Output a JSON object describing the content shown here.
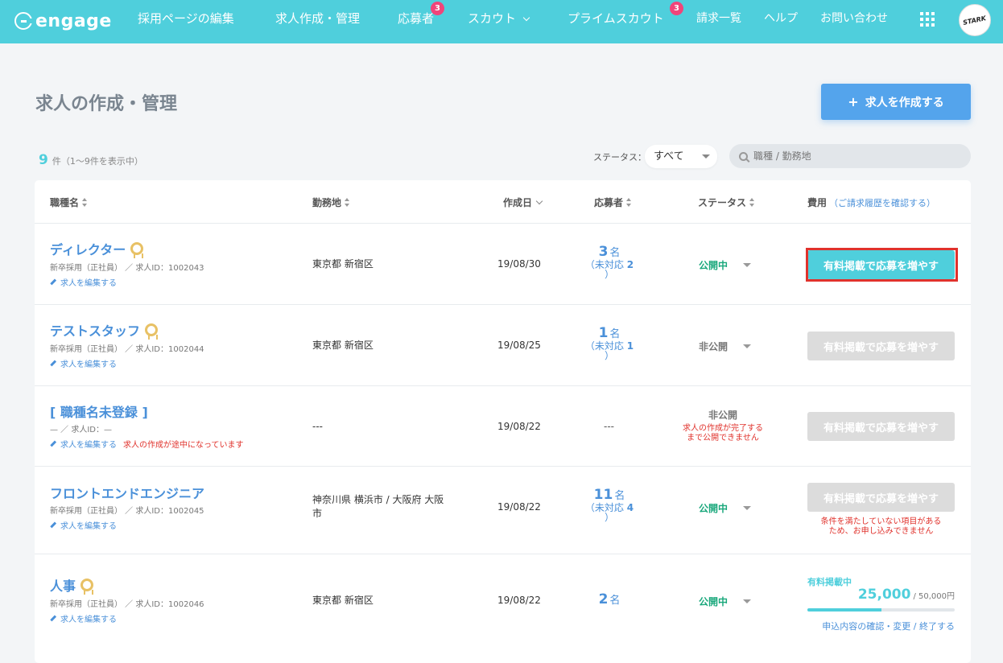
{
  "nav": {
    "logo": "engage",
    "items": [
      "採用ページの編集",
      "求人作成・管理",
      "応募者",
      "スカウト",
      "プライムスカウト",
      "請求一覧",
      "ヘルプ",
      "お問い合わせ"
    ],
    "applicants_badge": "3",
    "prime_badge": "3",
    "avatar_text": "STARK"
  },
  "page": {
    "title": "求人の作成・管理",
    "create_button": "求人を作成する",
    "create_plus": "+",
    "count": "9",
    "count_text": "件（1〜9件を表示中）",
    "status_label": "ステータス：",
    "status_value": "すべて",
    "search_placeholder": "職種 / 勤務地"
  },
  "table": {
    "headers": {
      "title": "職種名",
      "location": "勤務地",
      "date": "作成日",
      "applicants": "応募者",
      "status": "ステータス",
      "cost": "費用",
      "cost_link": "（ご請求履歴を確認する）"
    },
    "edit_label": "求人を編集する",
    "cost_button": "有料掲載で応募を増やす",
    "unit": "名",
    "pending_prefix": "（未対応",
    "pending_suffix": "）",
    "rows": [
      {
        "title": "ディレクター",
        "sub": "新卒採用（正社員） ／ 求人ID：1002043",
        "location": "東京都 新宿区",
        "date": "19/08/30",
        "applicants": "3",
        "pending": "2",
        "status": "公開中"
      },
      {
        "title": "テストスタッフ",
        "sub": "新卒採用（正社員） ／ 求人ID：1002044",
        "location": "東京都 新宿区",
        "date": "19/08/25",
        "applicants": "1",
        "pending": "1",
        "status": "非公開"
      },
      {
        "title": "[ 職種名未登録 ]",
        "sub": "— ／ 求人ID：—",
        "location": "---",
        "date": "19/08/22",
        "applicants": "---",
        "status": "非公開",
        "warn": "求人の作成が途中になっています",
        "status_note_1": "求人の作成が完了する",
        "status_note_2": "まで公開できません"
      },
      {
        "title": "フロントエンドエンジニア",
        "sub": "新卒採用（正社員） ／ 求人ID：1002045",
        "location_1": "神奈川県 横浜市 / 大阪府 大阪",
        "location_2": "市",
        "date": "19/08/22",
        "applicants": "11",
        "pending": "4",
        "status": "公開中",
        "cost_note_1": "条件を満たしていない項目がある",
        "cost_note_2": "ため、お申し込みできません"
      },
      {
        "title": "人事",
        "sub": "新卒採用（正社員） ／ 求人ID：1002046",
        "location": "東京都 新宿区",
        "date": "19/08/22",
        "applicants": "2",
        "status": "公開中",
        "paid_label": "有料掲載中",
        "paid_amount": "25,000",
        "paid_total": "/ 50,000円",
        "paid_progress": 0.5,
        "paid_links": "申込内容の確認・変更 / 終了する"
      }
    ]
  }
}
